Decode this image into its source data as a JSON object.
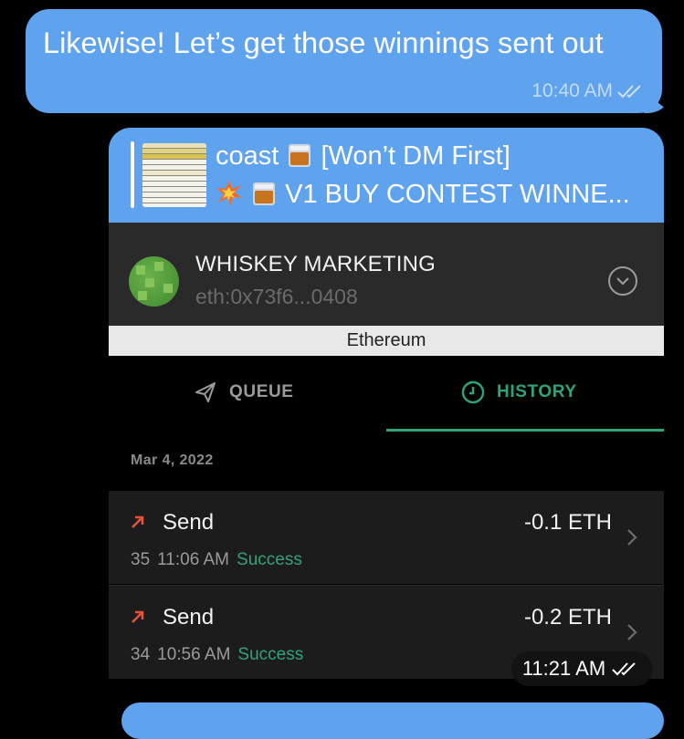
{
  "messages": {
    "outgoing_text": "Likewise! Let’s get those winnings sent out",
    "outgoing_time": "10:40 AM",
    "forwarded_time": "11:21 AM"
  },
  "reply": {
    "line1": "coast",
    "line1_suffix": "[Won’t DM First]",
    "line2": "V1 BUY CONTEST WINNE..."
  },
  "safe": {
    "name": "WHISKEY MARKETING",
    "address": "eth:0x73f6...0408",
    "network": "Ethereum"
  },
  "tabs": {
    "queue": "QUEUE",
    "history": "HISTORY",
    "active": "history"
  },
  "history": {
    "date": "Mar 4, 2022",
    "transactions": [
      {
        "kind": "Send",
        "amount": "-0.1 ETH",
        "nonce": "35",
        "time": "11:06 AM",
        "status": "Success"
      },
      {
        "kind": "Send",
        "amount": "-0.2 ETH",
        "nonce": "34",
        "time": "10:56 AM",
        "status": "Success"
      }
    ]
  },
  "colors": {
    "bubble": "#5fa2ee",
    "accent": "#2fa37a",
    "send_arrow": "#e5533d",
    "background": "#000000"
  },
  "icons": {
    "read_receipt": "double-check-icon",
    "expand": "chevron-down-circle-icon",
    "queue": "paper-plane-icon",
    "history": "clock-icon",
    "send": "arrow-up-right-icon",
    "row": "chevron-right-icon"
  }
}
